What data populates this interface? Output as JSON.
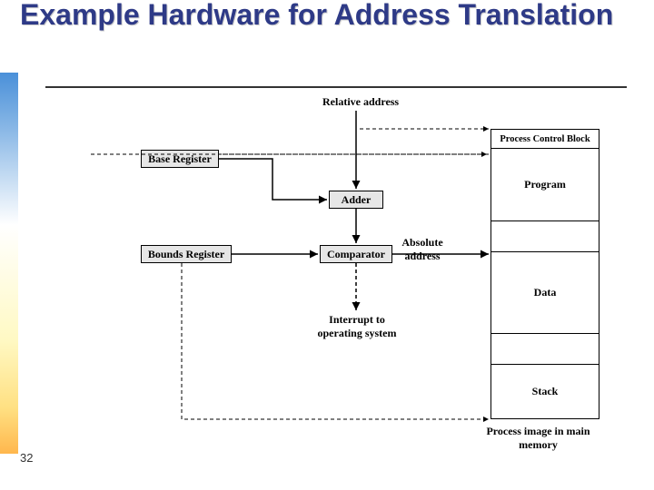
{
  "title": "Example Hardware for Address Translation",
  "slide_number": "32",
  "labels": {
    "relative_address": "Relative address",
    "absolute_address": "Absolute\naddress",
    "interrupt": "Interrupt to\noperating system",
    "mem_caption": "Process image in\nmain memory"
  },
  "boxes": {
    "base_register": "Base Register",
    "bounds_register": "Bounds Register",
    "adder": "Adder",
    "comparator": "Comparator"
  },
  "memory": {
    "pcb": "Process Control Block",
    "program": "Program",
    "data": "Data",
    "stack": "Stack"
  }
}
